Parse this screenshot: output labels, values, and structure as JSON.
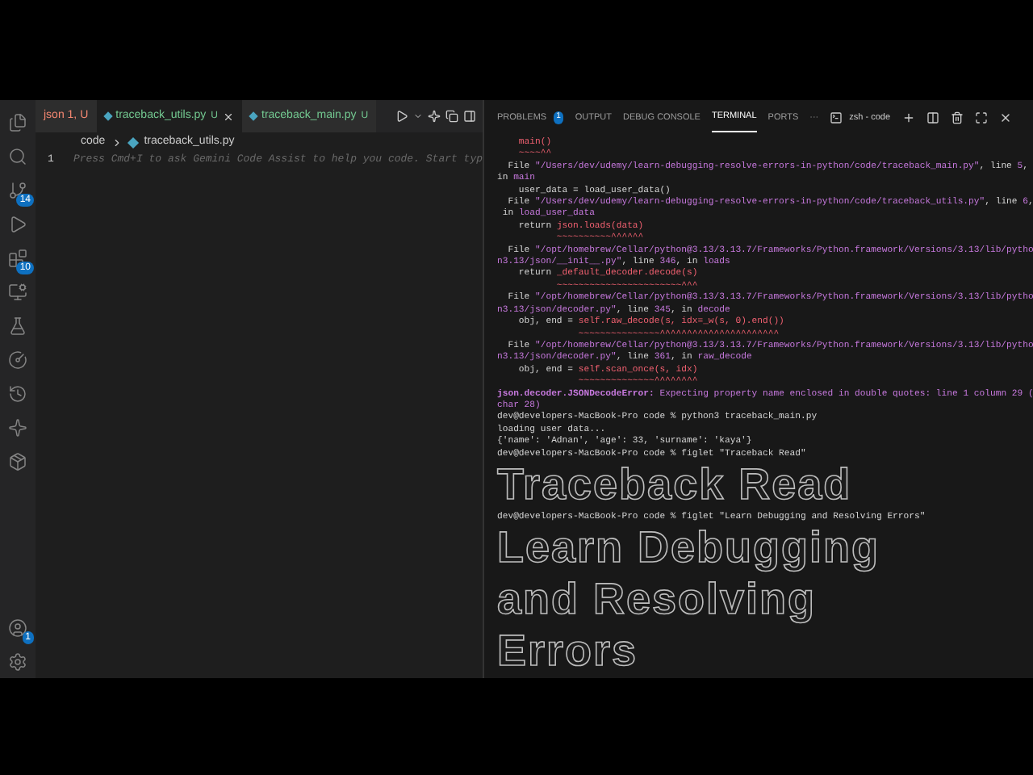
{
  "activity_bar": [
    {
      "kind": "files",
      "selected": false
    },
    {
      "kind": "search",
      "selected": false
    },
    {
      "kind": "source-control",
      "badge": "14",
      "selected": false
    },
    {
      "kind": "run",
      "selected": false
    },
    {
      "kind": "extensions",
      "badge": "10",
      "selected": false
    },
    {
      "kind": "remote",
      "selected": false
    },
    {
      "kind": "testing",
      "selected": false
    },
    {
      "kind": "timeline",
      "selected": false
    },
    {
      "kind": "history",
      "selected": false
    },
    {
      "kind": "sparkle",
      "selected": false
    },
    {
      "kind": "package",
      "selected": false
    }
  ],
  "accounts_badge": "1",
  "editor_tabs": [
    {
      "label": "json 1, U",
      "error": true,
      "selected": false
    },
    {
      "label": "traceback_utils.py",
      "status": "U",
      "error": false,
      "selected": true
    },
    {
      "label": "traceback_main.py",
      "status": "U",
      "error": false,
      "selected": false
    }
  ],
  "breadcrumb": {
    "folder": "code",
    "file": "traceback_utils.py"
  },
  "editor": {
    "line_number": "1",
    "placeholder": "Press Cmd+I to ask Gemini Code Assist to help you code. Start typ"
  },
  "panel_tabs": [
    {
      "label": "PROBLEMS",
      "badge": "1",
      "selected": false
    },
    {
      "label": "OUTPUT",
      "selected": false
    },
    {
      "label": "DEBUG CONSOLE",
      "selected": false
    },
    {
      "label": "TERMINAL",
      "selected": true
    },
    {
      "label": "PORTS",
      "selected": false
    }
  ],
  "panel_more": "···",
  "terminal_name": "zsh - code",
  "terminal": [
    {
      "kind": "code",
      "parts": [
        {
          "text": "    main()",
          "kind": "error"
        }
      ]
    },
    {
      "kind": "squiggle",
      "parts": [
        {
          "text": "    ~~~~^^",
          "kind": "squiggle"
        }
      ]
    },
    {
      "kind": "code",
      "parts": [
        {
          "text": "  File ",
          "kind": "plain"
        },
        {
          "text": "\"/Users/dev/udemy/learn-debugging-resolve-errors-in-python/code/traceback_main.py\"",
          "kind": "path"
        },
        {
          "text": ", line ",
          "kind": "plain"
        },
        {
          "text": "5",
          "kind": "path"
        },
        {
          "text": ",",
          "kind": "plain"
        }
      ]
    },
    {
      "kind": "code",
      "parts": [
        {
          "text": "in ",
          "kind": "plain"
        },
        {
          "text": "main",
          "kind": "path"
        }
      ]
    },
    {
      "kind": "code",
      "parts": [
        {
          "text": "    user_data = load_user_data()",
          "kind": "plain"
        }
      ]
    },
    {
      "kind": "code",
      "parts": [
        {
          "text": "  File ",
          "kind": "plain"
        },
        {
          "text": "\"/Users/dev/udemy/learn-debugging-resolve-errors-in-python/code/traceback_utils.py\"",
          "kind": "path"
        },
        {
          "text": ", line ",
          "kind": "plain"
        },
        {
          "text": "6",
          "kind": "path"
        },
        {
          "text": ",",
          "kind": "plain"
        }
      ]
    },
    {
      "kind": "code",
      "parts": [
        {
          "text": " in ",
          "kind": "plain"
        },
        {
          "text": "load_user_data",
          "kind": "path"
        }
      ]
    },
    {
      "kind": "code",
      "parts": [
        {
          "text": "    return ",
          "kind": "plain"
        },
        {
          "text": "json.loads(data)",
          "kind": "error"
        }
      ]
    },
    {
      "kind": "squiggle",
      "parts": [
        {
          "text": "           ~~~~~~~~~~^^^^^^",
          "kind": "squiggle"
        }
      ]
    },
    {
      "kind": "code",
      "parts": [
        {
          "text": "  File ",
          "kind": "plain"
        },
        {
          "text": "\"/opt/homebrew/Cellar/python@3.13/3.13.7/Frameworks/Python.framework/Versions/3.13/lib/pytho",
          "kind": "path"
        }
      ]
    },
    {
      "kind": "code",
      "parts": [
        {
          "text": "n3.13/json/__init__.py\"",
          "kind": "path"
        },
        {
          "text": ", line ",
          "kind": "plain"
        },
        {
          "text": "346",
          "kind": "path"
        },
        {
          "text": ", in ",
          "kind": "plain"
        },
        {
          "text": "loads",
          "kind": "path"
        }
      ]
    },
    {
      "kind": "code",
      "parts": [
        {
          "text": "    return ",
          "kind": "plain"
        },
        {
          "text": "_default_decoder.decode(s)",
          "kind": "error"
        }
      ]
    },
    {
      "kind": "squiggle",
      "parts": [
        {
          "text": "           ~~~~~~~~~~~~~~~~~~~~~~~^^^",
          "kind": "squiggle"
        }
      ]
    },
    {
      "kind": "code",
      "parts": [
        {
          "text": "  File ",
          "kind": "plain"
        },
        {
          "text": "\"/opt/homebrew/Cellar/python@3.13/3.13.7/Frameworks/Python.framework/Versions/3.13/lib/pytho",
          "kind": "path"
        }
      ]
    },
    {
      "kind": "code",
      "parts": [
        {
          "text": "n3.13/json/decoder.py\"",
          "kind": "path"
        },
        {
          "text": ", line ",
          "kind": "plain"
        },
        {
          "text": "345",
          "kind": "path"
        },
        {
          "text": ", in ",
          "kind": "plain"
        },
        {
          "text": "decode",
          "kind": "path"
        }
      ]
    },
    {
      "kind": "code",
      "parts": [
        {
          "text": "    obj, end = ",
          "kind": "plain"
        },
        {
          "text": "self.raw_decode(s, idx=_w(s, 0).end())",
          "kind": "error"
        }
      ]
    },
    {
      "kind": "squiggle",
      "parts": [
        {
          "text": "               ~~~~~~~~~~~~~~~^^^^^^^^^^^^^^^^^^^^^^",
          "kind": "squiggle"
        }
      ]
    },
    {
      "kind": "code",
      "parts": [
        {
          "text": "  File ",
          "kind": "plain"
        },
        {
          "text": "\"/opt/homebrew/Cellar/python@3.13/3.13.7/Frameworks/Python.framework/Versions/3.13/lib/pytho",
          "kind": "path"
        }
      ]
    },
    {
      "kind": "code",
      "parts": [
        {
          "text": "n3.13/json/decoder.py\"",
          "kind": "path"
        },
        {
          "text": ", line ",
          "kind": "plain"
        },
        {
          "text": "361",
          "kind": "path"
        },
        {
          "text": ", in ",
          "kind": "plain"
        },
        {
          "text": "raw_decode",
          "kind": "path"
        }
      ]
    },
    {
      "kind": "code",
      "parts": [
        {
          "text": "    obj, end = ",
          "kind": "plain"
        },
        {
          "text": "self.scan_once(s, idx)",
          "kind": "error"
        }
      ]
    },
    {
      "kind": "squiggle",
      "parts": [
        {
          "text": "               ~~~~~~~~~~~~~~^^^^^^^^",
          "kind": "squiggle"
        }
      ]
    },
    {
      "kind": "code",
      "parts": [
        {
          "text": "json.decoder.JSONDecodeError:",
          "kind": "exception"
        },
        {
          "text": " Expecting property name enclosed in double quotes: line 1 column 29 (",
          "kind": "path"
        }
      ]
    },
    {
      "kind": "code",
      "parts": [
        {
          "text": "char 28)",
          "kind": "path"
        }
      ]
    },
    {
      "kind": "code",
      "parts": [
        {
          "text": "dev@developers-MacBook-Pro code % python3 traceback_main.py",
          "kind": "plain"
        }
      ]
    },
    {
      "kind": "code",
      "parts": [
        {
          "text": "loading user data...",
          "kind": "plain"
        }
      ]
    },
    {
      "kind": "code",
      "parts": [
        {
          "text": "{'name': 'Adnan', 'age': 33, 'surname': 'kaya'}",
          "kind": "plain"
        }
      ]
    },
    {
      "kind": "code",
      "parts": [
        {
          "text": "dev@developers-MacBook-Pro code % figlet \"Traceback Read\"",
          "kind": "plain"
        }
      ]
    },
    {
      "kind": "banner",
      "text": "Traceback Read"
    },
    {
      "kind": "code",
      "parts": [
        {
          "text": "dev@developers-MacBook-Pro code % figlet \"Learn Debugging and Resolving Errors\"",
          "kind": "plain"
        }
      ]
    },
    {
      "kind": "banner",
      "text": "Learn Debugging"
    },
    {
      "kind": "banner",
      "text": "and Resolving"
    },
    {
      "kind": "banner",
      "text": "Errors"
    }
  ]
}
